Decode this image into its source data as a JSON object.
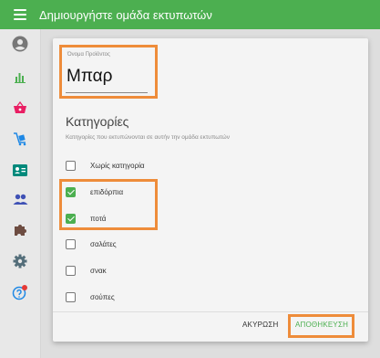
{
  "header": {
    "title": "Δημιουργήστε ομάδα εκτυπωτών"
  },
  "sidebar": {
    "icons": [
      "account-icon",
      "bar-chart-icon",
      "basket-icon",
      "cart-icon",
      "badge-icon",
      "people-icon",
      "puzzle-icon",
      "gear-icon",
      "help-icon"
    ]
  },
  "form": {
    "name_label": "Όνομα Προϊόντος",
    "name_value": "Μπαρ"
  },
  "categories": {
    "title": "Κατηγορίες",
    "subtitle": "Κατηγορίες που εκτυπώνονται σε αυτήν την ομάδα εκτυπωτών",
    "items": [
      {
        "label": "Χωρίς κατηγορία",
        "checked": false
      },
      {
        "label": "επιδόρπια",
        "checked": true
      },
      {
        "label": "ποτά",
        "checked": true
      },
      {
        "label": "σαλάτες",
        "checked": false
      },
      {
        "label": "σνακ",
        "checked": false
      },
      {
        "label": "σούπες",
        "checked": false
      }
    ]
  },
  "actions": {
    "cancel": "ΑΚΥΡΩΣΗ",
    "save": "ΑΠΟΘΗΚΕΥΣΗ"
  },
  "colors": {
    "primary": "#4caf50",
    "highlight": "#ee8c3a"
  }
}
